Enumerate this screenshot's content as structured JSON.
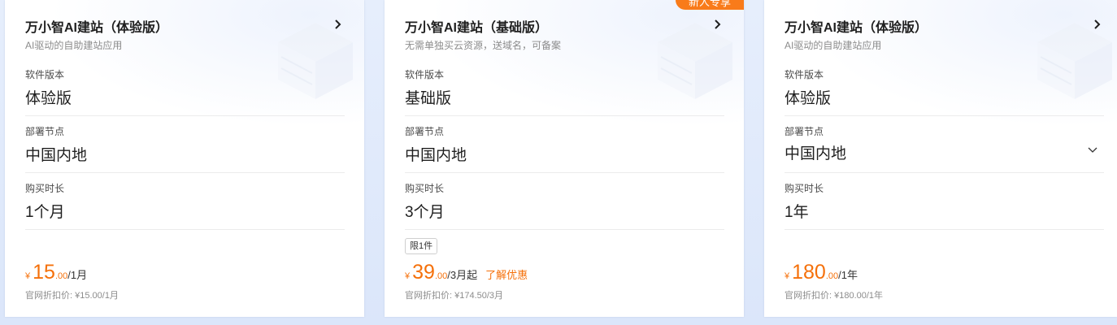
{
  "cards": [
    {
      "title": "万小智AI建站（体验版）",
      "subtitle": "AI驱动的自助建站应用",
      "version_label": "软件版本",
      "version_value": "体验版",
      "node_label": "部署节点",
      "node_value": "中国内地",
      "duration_label": "购买时长",
      "duration_value": "1个月",
      "price_currency": "¥",
      "price_integer": "15",
      "price_decimal": ".00",
      "price_unit": "/1月",
      "original_price": "官网折扣价: ¥15.00/1月"
    },
    {
      "ribbon": "新人专享",
      "title": "万小智AI建站（基础版）",
      "subtitle": "无需单独买云资源，送域名，可备案",
      "version_label": "软件版本",
      "version_value": "基础版",
      "node_label": "部署节点",
      "node_value": "中国内地",
      "duration_label": "购买时长",
      "duration_value": "3个月",
      "badge": "限1件",
      "price_currency": "¥",
      "price_integer": "39",
      "price_decimal": ".00",
      "price_unit": "/3月起",
      "promo_link": "了解优惠",
      "original_price": "官网折扣价: ¥174.50/3月"
    },
    {
      "title": "万小智AI建站（体验版）",
      "subtitle": "AI驱动的自助建站应用",
      "version_label": "软件版本",
      "version_value": "体验版",
      "node_label": "部署节点",
      "node_value": "中国内地",
      "duration_label": "购买时长",
      "duration_value": "1年",
      "price_currency": "¥",
      "price_integer": "180",
      "price_decimal": ".00",
      "price_unit": "/1年",
      "original_price": "官网折扣价: ¥180.00/1年"
    }
  ],
  "colors": {
    "accent": "#f5700a",
    "ribbon": "#f97b1a",
    "background": "#dde8fb"
  },
  "icons": {
    "card_chevron": "chevron-right-icon",
    "node_select": "chevron-down-icon",
    "decoration": "cube-illustration"
  }
}
